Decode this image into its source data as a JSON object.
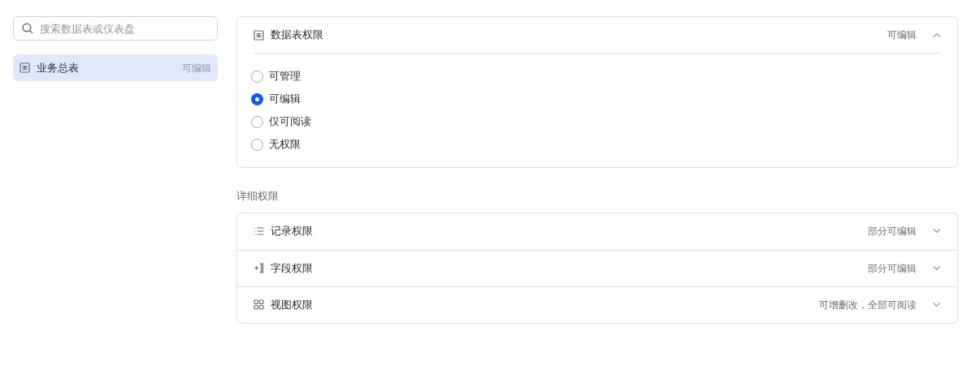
{
  "sidebar": {
    "search": {
      "placeholder": "搜索数据表或仪表盘"
    },
    "items": [
      {
        "label": "业务总表",
        "permission": "可编辑",
        "selected": true
      }
    ]
  },
  "table_permission": {
    "title": "数据表权限",
    "value": "可编辑",
    "expanded": true,
    "options": [
      {
        "label": "可管理",
        "selected": false
      },
      {
        "label": "可编辑",
        "selected": true
      },
      {
        "label": "仅可阅读",
        "selected": false
      },
      {
        "label": "无权限",
        "selected": false
      }
    ]
  },
  "detail": {
    "title": "详细权限",
    "items": [
      {
        "kind": "records",
        "label": "记录权限",
        "value": "部分可编辑",
        "expanded": false
      },
      {
        "kind": "fields",
        "label": "字段权限",
        "value": "部分可编辑",
        "expanded": false
      },
      {
        "kind": "views",
        "label": "视图权限",
        "value": "可增删改，全部可阅读",
        "expanded": false
      }
    ]
  }
}
